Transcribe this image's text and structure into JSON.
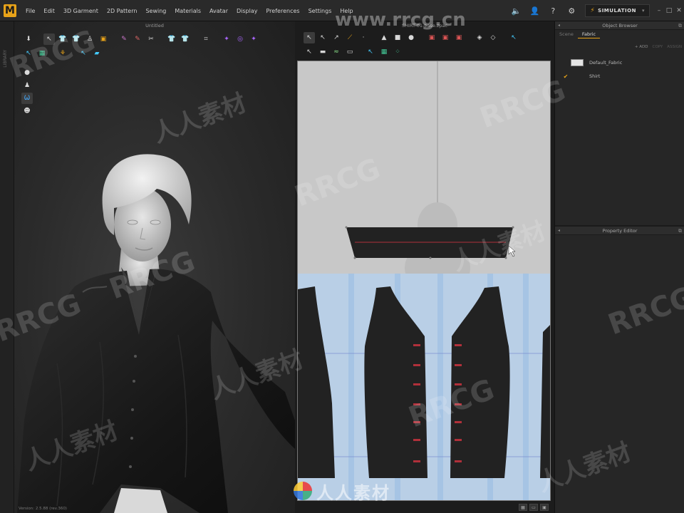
{
  "app": {
    "logo_letter": "M",
    "menus": [
      "File",
      "Edit",
      "3D Garment",
      "2D Pattern",
      "Sewing",
      "Materials",
      "Avatar",
      "Display",
      "Preferences",
      "Settings",
      "Help"
    ],
    "simulation_label": "SIMULATION",
    "accent_color": "#e8a319"
  },
  "left_strip": {
    "label": "LIBRARY"
  },
  "view3d": {
    "title": "Untitled",
    "status": "Version: 2.5.88     (rev.360)"
  },
  "view2d": {
    "title": "SHIRT-01-base.zpac"
  },
  "object_browser": {
    "title": "Object Browser",
    "tabs": [
      {
        "label": "Scene",
        "active": false
      },
      {
        "label": "Fabric",
        "active": true
      }
    ],
    "actions": [
      {
        "label": "+ ADD",
        "enabled": true
      },
      {
        "label": "COPY",
        "enabled": false
      },
      {
        "label": "ASSIGN",
        "enabled": false
      }
    ],
    "fabrics": [
      {
        "name": "Default_Fabric",
        "checked": false,
        "swatch": "#e4e4e4"
      },
      {
        "name": "Shirt",
        "checked": true,
        "swatch": "none"
      }
    ]
  },
  "property_editor": {
    "title": "Property Editor"
  },
  "watermark": {
    "repeated_text": "RRCG",
    "repeated_text_cn": "人人素材",
    "url_text": "www.rrcg.cn",
    "bottom_text": "人人素材"
  },
  "colors": {
    "menubar": "#2a2a2a",
    "viewport_bg": "#2f2f2f",
    "pattern_bg": "#c9c9c9",
    "pattern_grid": "#aecbe8",
    "pattern_piece": "#222222",
    "seam_line": "#b0303a"
  }
}
